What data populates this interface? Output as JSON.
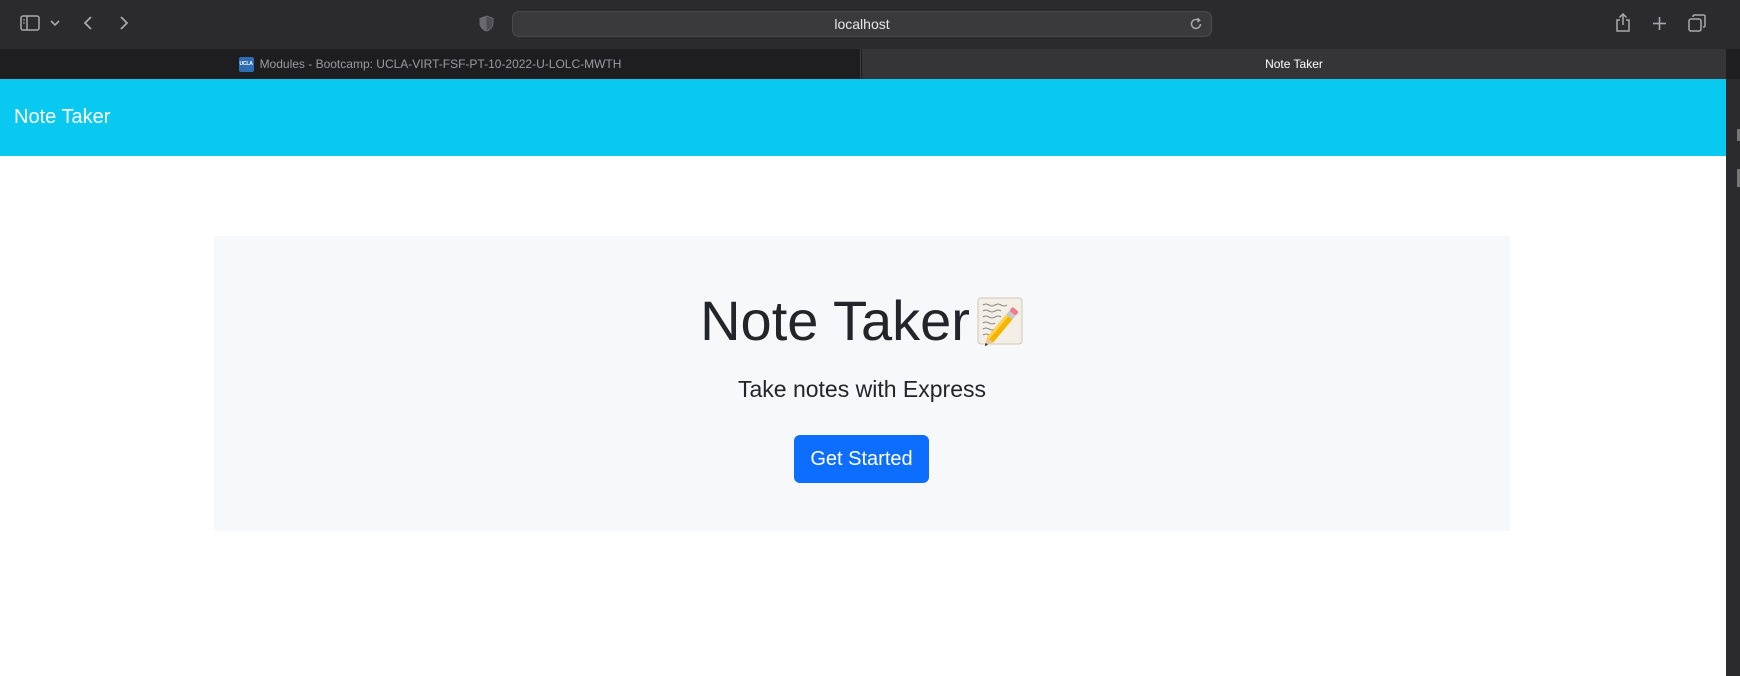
{
  "browser": {
    "address_url": "localhost",
    "tabs": [
      {
        "label": "Modules - Bootcamp: UCLA-VIRT-FSF-PT-10-2022-U-LOLC-MWTH",
        "favicon_text": "UCLA",
        "active": false
      },
      {
        "label": "Note Taker",
        "active": true
      }
    ],
    "icons": [
      "sidebar-icon",
      "chevron-down-icon",
      "back-icon",
      "forward-icon",
      "shield-icon",
      "reload-icon",
      "share-icon",
      "new-tab-icon",
      "tab-overview-icon"
    ]
  },
  "page": {
    "navbar_brand": "Note Taker",
    "hero_title": "Note Taker",
    "hero_emoji": "memo-pencil-icon",
    "hero_subtitle": "Take notes with Express",
    "cta_label": "Get Started"
  },
  "colors": {
    "navbar": "#0ac9f0",
    "primary_button": "#0d6efd",
    "jumbotron": "#f7f8f9"
  }
}
